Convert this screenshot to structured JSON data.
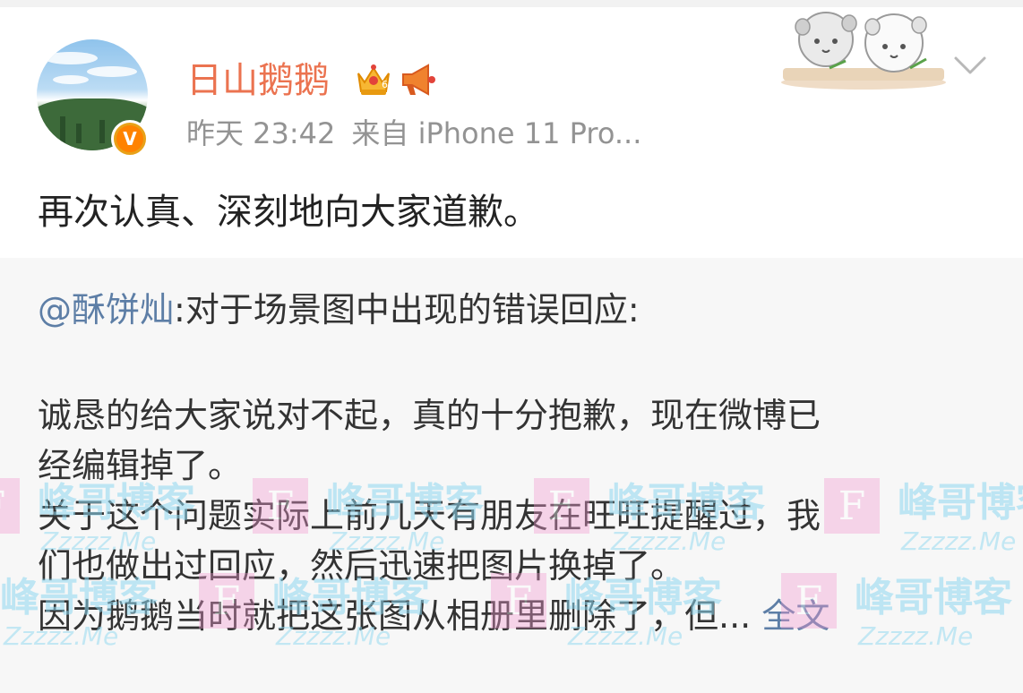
{
  "post": {
    "username": "日山鹅鹅",
    "time": "昨天 23:42",
    "source": "来自 iPhone 11 Pro...",
    "verified_badge": "V",
    "crown_level": "6",
    "text": "再次认真、深刻地向大家道歉。"
  },
  "repost": {
    "mention": "@酥饼灿",
    "title_rest": ":对于场景图中出现的错误回应:",
    "lines": [
      "诚恳的给大家说对不起，真的十分抱歉，现在微博已",
      "经编辑掉了。",
      "关于这个问题实际上前几天有朋友在旺旺提醒过，我",
      "们也做出过回应，然后迅速把图片换掉了。"
    ],
    "last_line": "因为鹅鹅当时就把这张图从相册里删除了，但... ",
    "full_text_link": "全文"
  },
  "watermark": {
    "letter": "F",
    "cn": "峰哥博客",
    "en": "Zzzzz.Me"
  },
  "icons": {
    "crown": "vip-crown-icon",
    "horn": "megaphone-icon",
    "chevron": "chevron-down-icon"
  },
  "colors": {
    "username": "#eb7350",
    "link": "#5d7ea6",
    "meta": "#939393"
  }
}
